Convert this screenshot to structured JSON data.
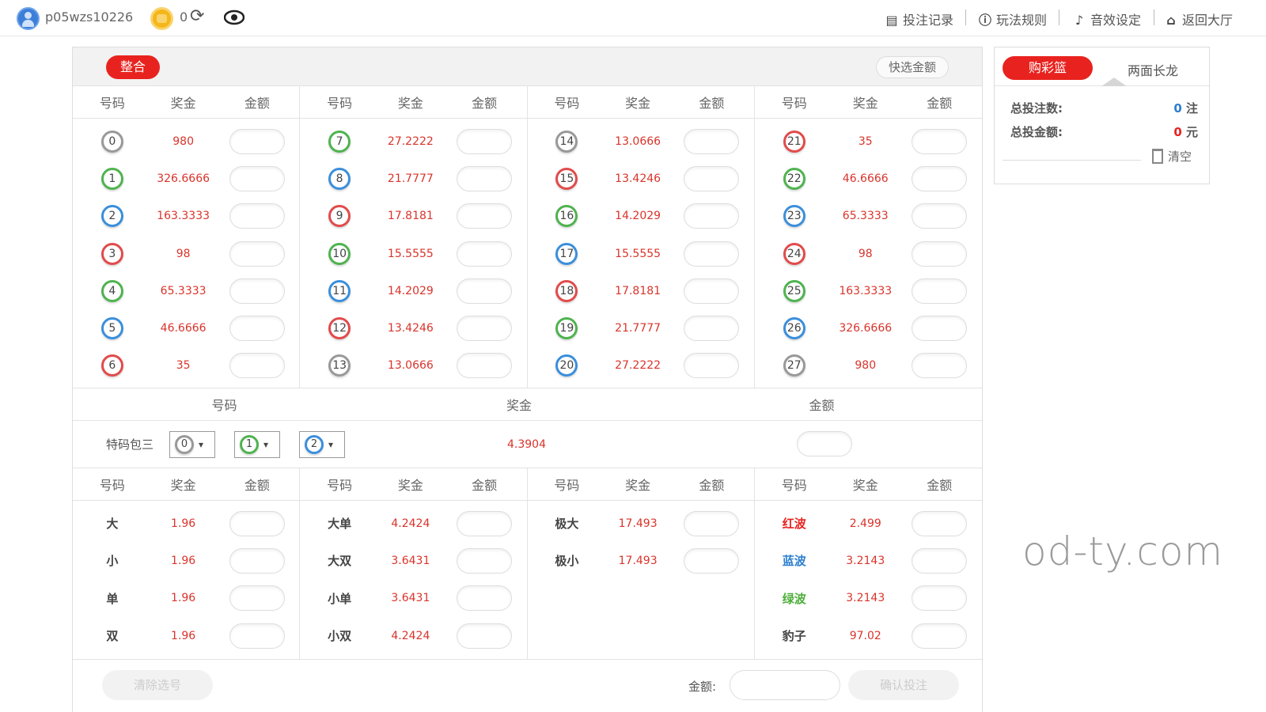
{
  "topbar": {
    "username": "p05wzs10226",
    "balance": "0",
    "nav": [
      "投注记录",
      "玩法规则",
      "音效设定",
      "返回大厅"
    ]
  },
  "main": {
    "tab": "整合",
    "quick_amount": "快选金额",
    "headers": {
      "number": "号码",
      "odds": "奖金",
      "amount": "金额"
    }
  },
  "sum_columns": [
    [
      {
        "n": "0",
        "c": "gray",
        "odds": "980"
      },
      {
        "n": "1",
        "c": "green",
        "odds": "326.6666"
      },
      {
        "n": "2",
        "c": "blue",
        "odds": "163.3333"
      },
      {
        "n": "3",
        "c": "red",
        "odds": "98"
      },
      {
        "n": "4",
        "c": "green",
        "odds": "65.3333"
      },
      {
        "n": "5",
        "c": "blue",
        "odds": "46.6666"
      },
      {
        "n": "6",
        "c": "red",
        "odds": "35"
      }
    ],
    [
      {
        "n": "7",
        "c": "green",
        "odds": "27.2222"
      },
      {
        "n": "8",
        "c": "blue",
        "odds": "21.7777"
      },
      {
        "n": "9",
        "c": "red",
        "odds": "17.8181"
      },
      {
        "n": "10",
        "c": "green",
        "odds": "15.5555"
      },
      {
        "n": "11",
        "c": "blue",
        "odds": "14.2029"
      },
      {
        "n": "12",
        "c": "red",
        "odds": "13.4246"
      },
      {
        "n": "13",
        "c": "gray",
        "odds": "13.0666"
      }
    ],
    [
      {
        "n": "14",
        "c": "gray",
        "odds": "13.0666"
      },
      {
        "n": "15",
        "c": "red",
        "odds": "13.4246"
      },
      {
        "n": "16",
        "c": "green",
        "odds": "14.2029"
      },
      {
        "n": "17",
        "c": "blue",
        "odds": "15.5555"
      },
      {
        "n": "18",
        "c": "red",
        "odds": "17.8181"
      },
      {
        "n": "19",
        "c": "green",
        "odds": "21.7777"
      },
      {
        "n": "20",
        "c": "blue",
        "odds": "27.2222"
      }
    ],
    [
      {
        "n": "21",
        "c": "red",
        "odds": "35"
      },
      {
        "n": "22",
        "c": "green",
        "odds": "46.6666"
      },
      {
        "n": "23",
        "c": "blue",
        "odds": "65.3333"
      },
      {
        "n": "24",
        "c": "red",
        "odds": "98"
      },
      {
        "n": "25",
        "c": "green",
        "odds": "163.3333"
      },
      {
        "n": "26",
        "c": "blue",
        "odds": "326.6666"
      },
      {
        "n": "27",
        "c": "gray",
        "odds": "980"
      }
    ]
  ],
  "special": {
    "label": "特码包三",
    "selects": [
      {
        "n": "0",
        "c": "gray"
      },
      {
        "n": "1",
        "c": "green"
      },
      {
        "n": "2",
        "c": "blue"
      }
    ],
    "odds": "4.3904"
  },
  "bottom_columns": [
    [
      {
        "label": "大",
        "odds": "1.96"
      },
      {
        "label": "小",
        "odds": "1.96"
      },
      {
        "label": "单",
        "odds": "1.96"
      },
      {
        "label": "双",
        "odds": "1.96"
      }
    ],
    [
      {
        "label": "大单",
        "odds": "4.2424"
      },
      {
        "label": "大双",
        "odds": "3.6431"
      },
      {
        "label": "小单",
        "odds": "3.6431"
      },
      {
        "label": "小双",
        "odds": "4.2424"
      }
    ],
    [
      {
        "label": "极大",
        "odds": "17.493"
      },
      {
        "label": "极小",
        "odds": "17.493"
      }
    ],
    [
      {
        "label": "红波",
        "odds": "2.499",
        "color": "red"
      },
      {
        "label": "蓝波",
        "odds": "3.2143",
        "color": "blue"
      },
      {
        "label": "绿波",
        "odds": "3.2143",
        "color": "green"
      },
      {
        "label": "豹子",
        "odds": "97.02"
      }
    ]
  ],
  "footer": {
    "clear": "清除选号",
    "amount_label": "金额:",
    "confirm": "确认投注"
  },
  "side": {
    "tab_active": "购彩篮",
    "tab_other": "两面长龙",
    "total_bets_label": "总投注数:",
    "total_bets": "0",
    "total_bets_unit": "注",
    "total_amount_label": "总投金额:",
    "total_amount": "0",
    "total_amount_unit": "元",
    "clear": "清空"
  },
  "watermark": "od-ty.com"
}
